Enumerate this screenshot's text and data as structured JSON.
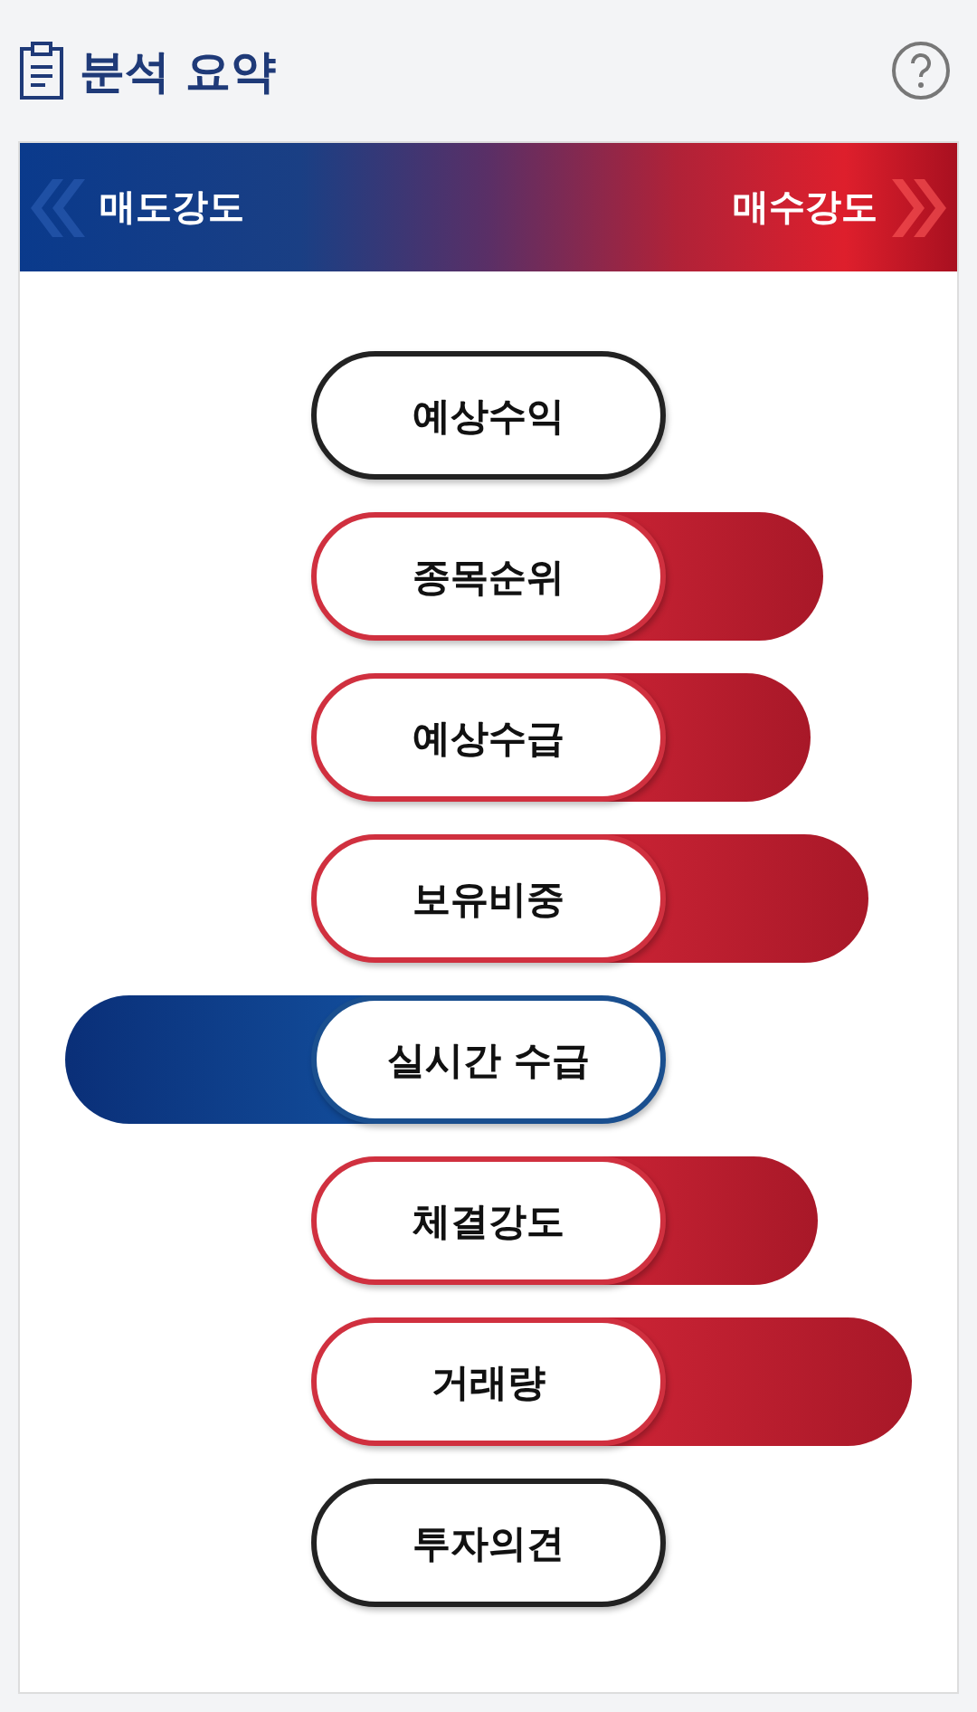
{
  "header": {
    "title": "분석 요약"
  },
  "scale": {
    "sell_label": "매도강도",
    "buy_label": "매수강도"
  },
  "items": [
    {
      "label": "예상수익",
      "kind": "neutral"
    },
    {
      "label": "종목순위",
      "kind": "buy"
    },
    {
      "label": "예상수급",
      "kind": "buy"
    },
    {
      "label": "보유비중",
      "kind": "buy"
    },
    {
      "label": "실시간 수급",
      "kind": "sell"
    },
    {
      "label": "체결강도",
      "kind": "buy"
    },
    {
      "label": "거래량",
      "kind": "buy"
    },
    {
      "label": "투자의견",
      "kind": "neutral"
    }
  ]
}
